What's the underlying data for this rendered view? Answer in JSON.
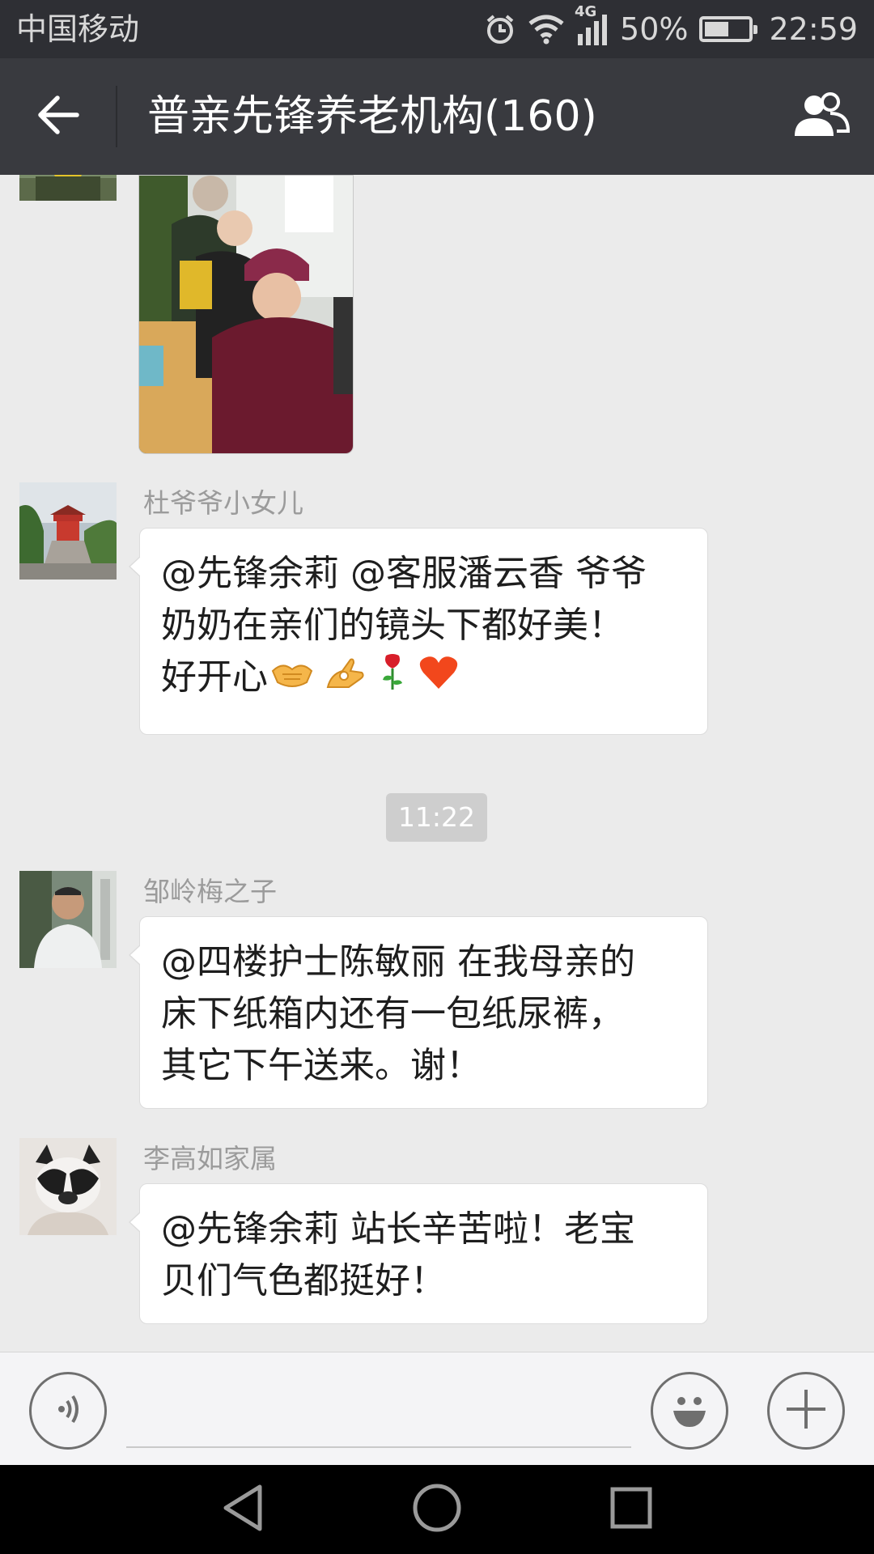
{
  "status_bar": {
    "carrier": "中国移动",
    "network": "4G",
    "battery_percent": "50%",
    "battery_level": 0.5,
    "time": "22:59",
    "icons": [
      "alarm-icon",
      "wifi-icon",
      "signal-icon",
      "battery-icon"
    ]
  },
  "header": {
    "title": "普亲先锋养老机构(160)",
    "back_icon": "back-arrow-icon",
    "members_icon": "group-members-icon"
  },
  "messages": [
    {
      "type": "image",
      "description_icon": "photo-message"
    },
    {
      "type": "text",
      "sender": "杜爷爷小女儿",
      "lines": [
        "@先锋余莉 @客服潘云香 爷爷",
        "奶奶在亲们的镜头下都好美！",
        "好开心"
      ],
      "emojis": [
        "handshake-emoji",
        "ok-hand-emoji",
        "rose-emoji",
        "heart-emoji"
      ]
    },
    {
      "type": "time",
      "text": "11:22"
    },
    {
      "type": "text",
      "sender": "邹岭梅之子",
      "lines": [
        "@四楼护士陈敏丽 在我母亲的",
        "床下纸箱内还有一包纸尿裤，",
        "其它下午送来。谢！"
      ]
    },
    {
      "type": "text",
      "sender": "李高如家属",
      "lines": [
        "@先锋余莉 站长辛苦啦！老宝",
        "贝们气色都挺好！"
      ]
    }
  ],
  "input_bar": {
    "voice_icon": "voice-icon",
    "emoji_icon": "emoji-icon",
    "more_icon": "plus-icon"
  },
  "colors": {
    "status_bar_bg": "#2e2f34",
    "title_bar_bg": "#393a3f",
    "chat_bg": "#ebebeb",
    "bubble_bg": "#ffffff",
    "sender_text": "#9b9b9b",
    "time_pill_bg": "#cecece"
  }
}
